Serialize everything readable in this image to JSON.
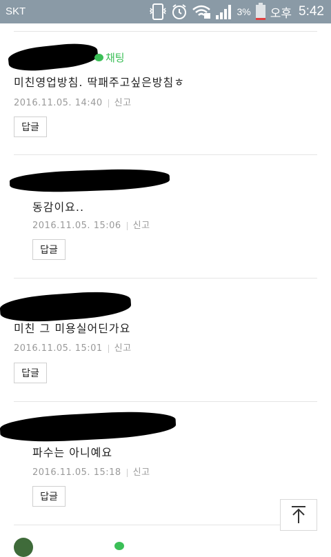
{
  "status_bar": {
    "carrier": "SKT",
    "battery": "3%",
    "ampm": "오후",
    "time": "5:42"
  },
  "comments": [
    {
      "chat_label": "채팅",
      "text": "미친영업방침. 딱패주고싶은방침ㅎ",
      "date": "2016.11.05. 14:40",
      "report": "신고",
      "reply": "답글"
    },
    {
      "text": "동감이요..",
      "date": "2016.11.05. 15:06",
      "report": "신고",
      "reply": "답글"
    },
    {
      "text": "미친 그 미용실어딘가요",
      "date": "2016.11.05. 15:01",
      "report": "신고",
      "reply": "답글"
    },
    {
      "text": "파수는 아니예요",
      "date": "2016.11.05. 15:18",
      "report": "신고",
      "reply": "답글"
    }
  ],
  "icons": {
    "scroll_top": "arrow-up-icon",
    "chat": "chat-bubble-icon"
  },
  "colors": {
    "status_bar": "#8a9aa6",
    "chat_green": "#3bbf57"
  }
}
